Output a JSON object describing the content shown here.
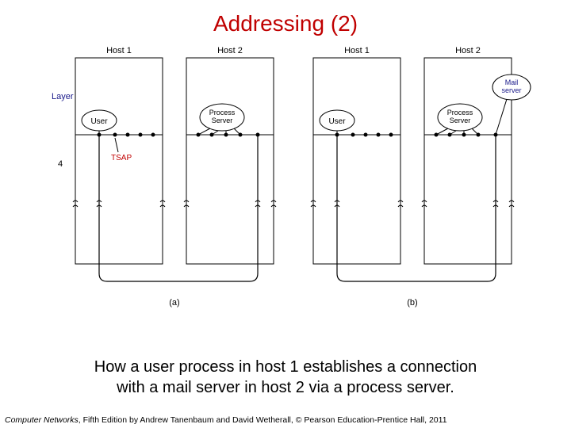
{
  "title": "Addressing (2)",
  "labels": {
    "host1": "Host 1",
    "host2": "Host 2",
    "layer": "Layer",
    "four": "4",
    "user": "User",
    "process_server": "Process",
    "process_server2": "Server",
    "mail": "Mail",
    "mail2": "server",
    "tsap": "TSAP",
    "panel_a": "(a)",
    "panel_b": "(b)"
  },
  "caption_line1": "How a user process in host 1 establishes a connection",
  "caption_line2": "with a mail server in host 2 via a process server.",
  "footer_book": "Computer Networks",
  "footer_rest": ", Fifth Edition by Andrew Tanenbaum and David Wetherall, © Pearson Education-Prentice Hall, 2011"
}
